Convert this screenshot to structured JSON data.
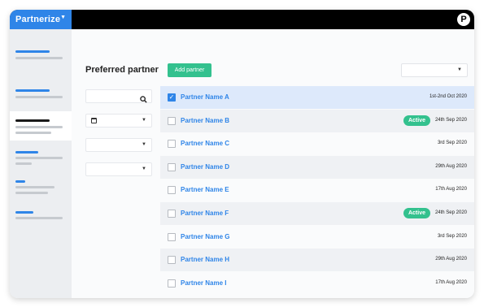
{
  "brand": {
    "name": "Partnerize",
    "user_logo_letter": "P"
  },
  "page": {
    "title": "Preferred partner",
    "add_button_label": "Add partner"
  },
  "colors": {
    "brand_blue": "#2f85e8",
    "active_green": "#33c18e",
    "topbar": "#000000"
  },
  "icons": {
    "search": "search-icon",
    "calendar": "calendar-icon",
    "caret": "chevron-down-icon"
  },
  "partners": [
    {
      "name": "Partner Name A",
      "date": "1st-2nd Oct 2020",
      "status": "",
      "checked": true
    },
    {
      "name": "Partner Name B",
      "date": "24th Sep 2020",
      "status": "Active",
      "checked": false
    },
    {
      "name": "Partner Name C",
      "date": "3rd Sep 2020",
      "status": "",
      "checked": false
    },
    {
      "name": "Partner Name D",
      "date": "29th Aug 2020",
      "status": "",
      "checked": false
    },
    {
      "name": "Partner Name E",
      "date": "17th Aug 2020",
      "status": "",
      "checked": false
    },
    {
      "name": "Partner Name F",
      "date": "24th Sep 2020",
      "status": "Active",
      "checked": false
    },
    {
      "name": "Partner Name G",
      "date": "3rd Sep 2020",
      "status": "",
      "checked": false
    },
    {
      "name": "Partner Name H",
      "date": "29th Aug 2020",
      "status": "",
      "checked": false
    },
    {
      "name": "Partner Name I",
      "date": "17th Aug 2020",
      "status": "",
      "checked": false
    }
  ]
}
